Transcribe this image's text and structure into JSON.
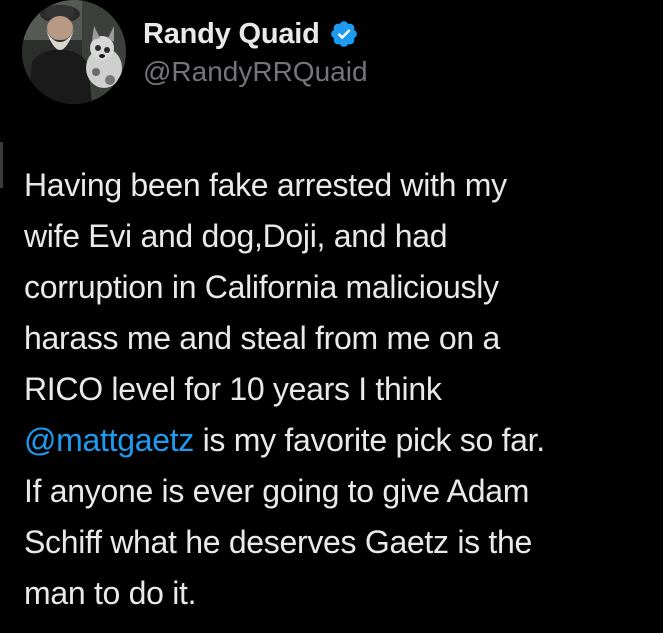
{
  "author": {
    "display_name": "Randy Quaid",
    "handle": "@RandyRRQuaid",
    "verified": true,
    "verified_color": "#1d9bf0",
    "avatar_icon": "profile-photo-man-with-dog"
  },
  "tweet": {
    "lines": [
      "Having been fake arrested with my",
      "wife Evi and dog,Doji, and had",
      "corruption in California maliciously",
      "harass me and steal from me on a",
      "RICO level for 10 years  I think"
    ],
    "mention": "@mattgaetz",
    "mention_line_rest": " is my favorite pick so far.",
    "lines_after": [
      "If anyone is ever going to give Adam",
      "Schiff what he deserves Gaetz is the",
      "man to do it."
    ]
  },
  "colors": {
    "background": "#000000",
    "text_primary": "#e7e9ea",
    "text_secondary": "#71767b",
    "link": "#1d9bf0"
  }
}
